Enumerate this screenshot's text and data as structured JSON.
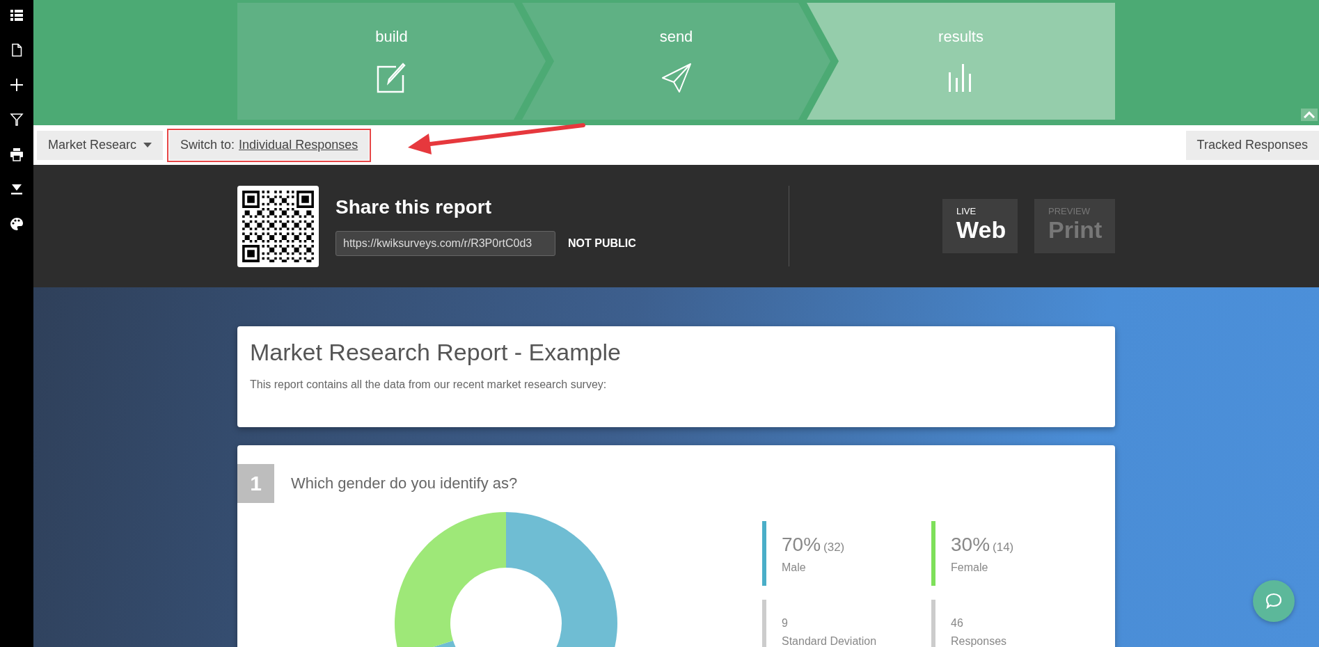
{
  "sidebar": {
    "items": [
      {
        "kind": "list"
      },
      {
        "kind": "document"
      },
      {
        "kind": "plus"
      },
      {
        "kind": "filter"
      },
      {
        "kind": "print"
      },
      {
        "kind": "download"
      },
      {
        "kind": "palette"
      }
    ]
  },
  "steps": [
    {
      "label": "build",
      "kind": "build",
      "selected": false
    },
    {
      "label": "send",
      "kind": "send",
      "selected": false
    },
    {
      "label": "results",
      "kind": "results",
      "selected": true
    }
  ],
  "toolbar": {
    "report_dropdown": "Market Researc",
    "switch_prefix": "Switch to:",
    "switch_link": "Individual Responses",
    "tracked_button": "Tracked Responses"
  },
  "share": {
    "title": "Share this report",
    "url": "https://kwiksurveys.com/r/R3P0rtC0d3",
    "visibility": "NOT PUBLIC",
    "modes": [
      {
        "caption": "LIVE",
        "label": "Web",
        "selected": true
      },
      {
        "caption": "PREVIEW",
        "label": "Print",
        "selected": false
      }
    ]
  },
  "report": {
    "title": "Market Research Report - Example",
    "description": "This report contains all the data from our recent market research survey:"
  },
  "question": {
    "number": "1",
    "text": "Which gender do you identify as?",
    "chart_data": {
      "type": "donut",
      "values": [
        70,
        30
      ]
    },
    "stats": [
      {
        "kind": "percent",
        "value": "70%",
        "count": "(32)",
        "label": "Male",
        "color": "#4aaec8"
      },
      {
        "kind": "percent",
        "value": "30%",
        "count": "(14)",
        "label": "Female",
        "color": "#7ee05a"
      },
      {
        "kind": "number",
        "value": "9",
        "label": "Standard Deviation",
        "color": "#cccccc"
      },
      {
        "kind": "number",
        "value": "46",
        "label": "Responses",
        "color": "#cccccc"
      }
    ]
  }
}
